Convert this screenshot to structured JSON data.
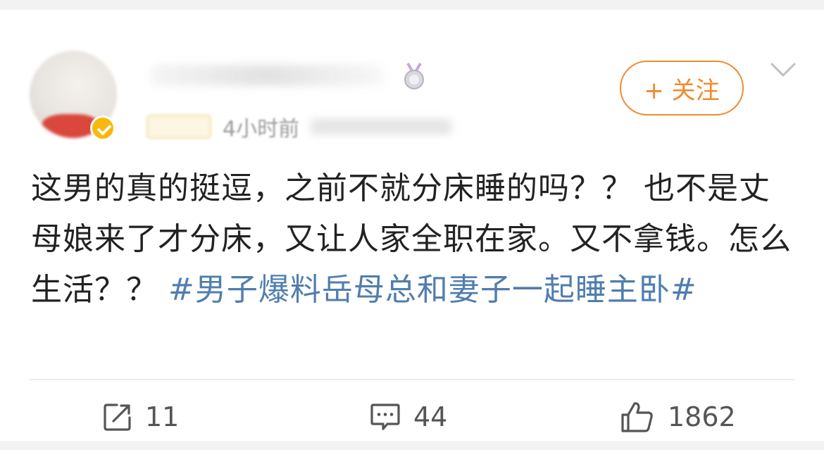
{
  "post": {
    "time_text": "4小时前",
    "follow_label": "+ 关注",
    "text_plain": "这男的真的挺逗，之前不就分床睡的吗？？ 也不是丈母娘来了才分床，又让人家全职在家。又不拿钱。怎么生活？？",
    "topic": "#男子爆料岳母总和妻子一起睡主卧#"
  },
  "actions": {
    "repost_count": "11",
    "comment_count": "44",
    "like_count": "1862"
  },
  "icons": {
    "more": "chevron-down-icon",
    "repost": "share-icon",
    "comment": "comment-icon",
    "like": "thumbs-up-icon",
    "verified": "verified-badge-icon",
    "medal": "medal-icon"
  },
  "colors": {
    "accent": "#f08a2f",
    "topic": "#507daf",
    "text": "#222222",
    "meta": "#9a9a9a"
  }
}
